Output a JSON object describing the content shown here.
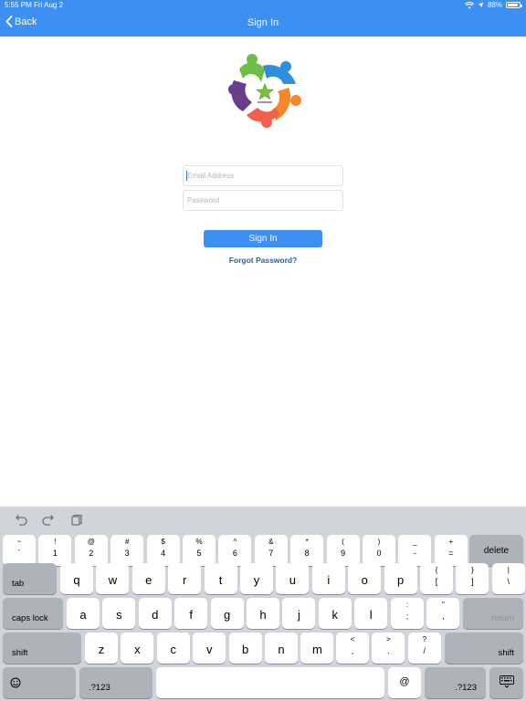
{
  "status_bar": {
    "time": "5:55 PM",
    "date": "Fri Aug 2",
    "battery": "88%",
    "battery_level": 0.88
  },
  "nav": {
    "back_label": "Back",
    "title": "Sign In"
  },
  "form": {
    "email_placeholder": "Email Address",
    "password_placeholder": "Password",
    "signin_label": "Sign In",
    "forgot_label": "Forgot Password?"
  },
  "colors": {
    "accent": "#3d8ff2",
    "link": "#2a5fa8",
    "keyboard_bg": "#d1d4da"
  },
  "keyboard": {
    "row1": [
      {
        "s": "~",
        "p": "`"
      },
      {
        "s": "!",
        "p": "1"
      },
      {
        "s": "@",
        "p": "2"
      },
      {
        "s": "#",
        "p": "3"
      },
      {
        "s": "$",
        "p": "4"
      },
      {
        "s": "%",
        "p": "5"
      },
      {
        "s": "^",
        "p": "6"
      },
      {
        "s": "&",
        "p": "7"
      },
      {
        "s": "*",
        "p": "8"
      },
      {
        "s": "(",
        "p": "9"
      },
      {
        "s": ")",
        "p": "0"
      },
      {
        "s": "_",
        "p": "-"
      },
      {
        "s": "+",
        "p": "="
      }
    ],
    "delete": "delete",
    "tab": "tab",
    "row2": [
      "q",
      "w",
      "e",
      "r",
      "t",
      "y",
      "u",
      "i",
      "o",
      "p"
    ],
    "row2_sym": [
      {
        "s": "{",
        "p": "["
      },
      {
        "s": "}",
        "p": "]"
      },
      {
        "s": "|",
        "p": "\\"
      }
    ],
    "caps": "caps lock",
    "row3": [
      "a",
      "s",
      "d",
      "f",
      "g",
      "h",
      "j",
      "k",
      "l"
    ],
    "row3_sym": [
      {
        "s": ":",
        "p": ";"
      },
      {
        "s": "\"",
        "p": ","
      }
    ],
    "return": "return",
    "shift": "shift",
    "row4": [
      "z",
      "x",
      "c",
      "v",
      "b",
      "n",
      "m"
    ],
    "row4_sym": [
      {
        "s": "<",
        "p": ","
      },
      {
        "s": ">",
        "p": "."
      },
      {
        "s": "?",
        "p": "/"
      }
    ],
    "emoji_icon": "emoji-icon",
    "num_switch": ".?123",
    "at": "@",
    "toolbar_icons": [
      "undo-icon",
      "redo-icon",
      "paste-icon"
    ]
  }
}
